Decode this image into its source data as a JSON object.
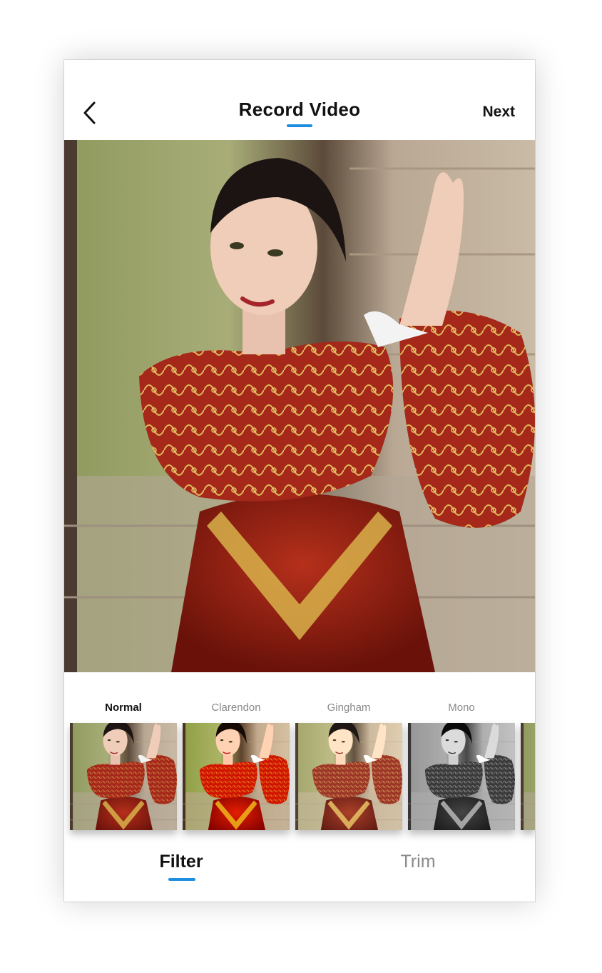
{
  "header": {
    "back_icon": "chevron-left-icon",
    "title": "Record Video",
    "next_label": "Next",
    "accent_color": "#1e8fe0"
  },
  "preview": {
    "subject": "photo-preview"
  },
  "filters": {
    "selected": "Normal",
    "items": [
      {
        "label": "Normal",
        "active": true
      },
      {
        "label": "Clarendon",
        "active": false
      },
      {
        "label": "Gingham",
        "active": false
      },
      {
        "label": "Mono",
        "active": false
      }
    ]
  },
  "tabs": {
    "items": [
      {
        "label": "Filter",
        "active": true
      },
      {
        "label": "Trim",
        "active": false
      }
    ]
  }
}
